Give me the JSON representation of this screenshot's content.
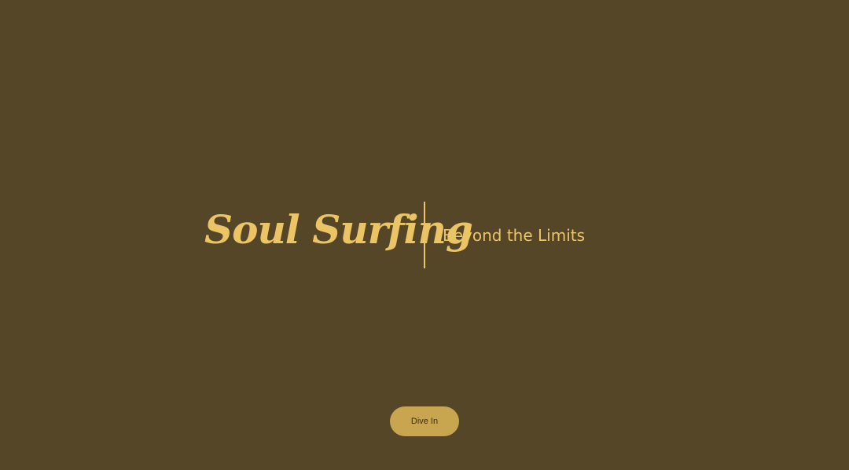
{
  "hero": {
    "title": "Soul Surfing",
    "tagline": "Beyond the Limits"
  },
  "cta": {
    "label": "Dive In"
  },
  "colors": {
    "background": "#554627",
    "accent": "#EBC565",
    "button_bg": "#C8A54F",
    "button_text": "#3A2F18"
  }
}
